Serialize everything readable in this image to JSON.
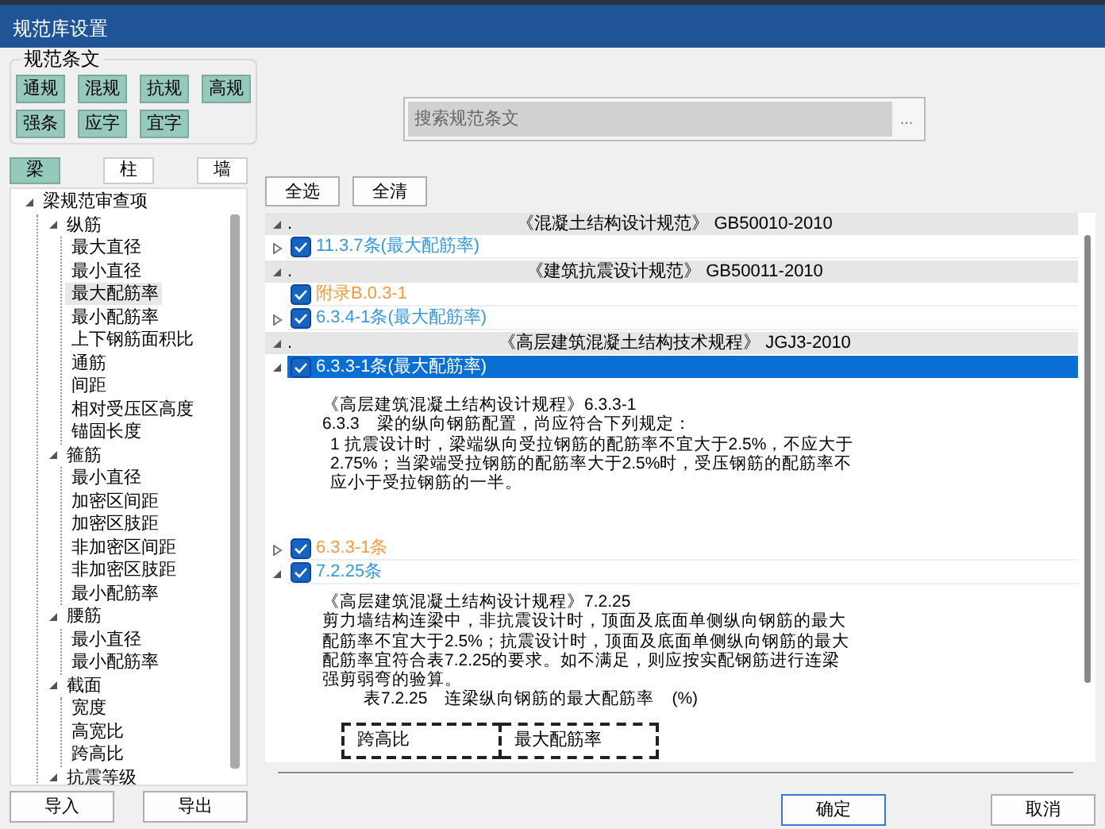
{
  "window": {
    "title": "规范库设置"
  },
  "filter_group": {
    "legend": "规范条文",
    "buttons": [
      {
        "label": "通规",
        "selected": true
      },
      {
        "label": "混规",
        "selected": true
      },
      {
        "label": "抗规",
        "selected": true
      },
      {
        "label": "高规",
        "selected": true
      },
      {
        "label": "强条",
        "selected": true
      },
      {
        "label": "应字",
        "selected": true
      },
      {
        "label": "宜字",
        "selected": true
      }
    ]
  },
  "search": {
    "placeholder": "搜索规范条文",
    "button": "..."
  },
  "member_tabs": [
    {
      "label": "梁",
      "selected": true
    },
    {
      "label": "柱",
      "selected": false
    },
    {
      "label": "墙",
      "selected": false
    }
  ],
  "tree": [
    {
      "label": "梁规范审查项",
      "expanded": true,
      "selected": false,
      "children": [
        {
          "label": "纵筋",
          "expanded": true,
          "selected": false,
          "children": [
            {
              "label": "最大直径",
              "selected": false
            },
            {
              "label": "最小直径",
              "selected": false
            },
            {
              "label": "最大配筋率",
              "selected": true
            },
            {
              "label": "最小配筋率",
              "selected": false
            },
            {
              "label": "上下钢筋面积比",
              "selected": false
            },
            {
              "label": "通筋",
              "selected": false
            },
            {
              "label": "间距",
              "selected": false
            },
            {
              "label": "相对受压区高度",
              "selected": false
            },
            {
              "label": "锚固长度",
              "selected": false
            }
          ]
        },
        {
          "label": "箍筋",
          "expanded": true,
          "selected": false,
          "children": [
            {
              "label": "最小直径",
              "selected": false
            },
            {
              "label": "加密区间距",
              "selected": false
            },
            {
              "label": "加密区肢距",
              "selected": false
            },
            {
              "label": "非加密区间距",
              "selected": false
            },
            {
              "label": "非加密区肢距",
              "selected": false
            },
            {
              "label": "最小配筋率",
              "selected": false
            }
          ]
        },
        {
          "label": "腰筋",
          "expanded": true,
          "selected": false,
          "children": [
            {
              "label": "最小直径",
              "selected": false
            },
            {
              "label": "最小配筋率",
              "selected": false
            }
          ]
        },
        {
          "label": "截面",
          "expanded": true,
          "selected": false,
          "children": [
            {
              "label": "宽度",
              "selected": false
            },
            {
              "label": "高宽比",
              "selected": false
            },
            {
              "label": "跨高比",
              "selected": false
            }
          ]
        },
        {
          "label": "抗震等级",
          "expanded": true,
          "selected": false
        }
      ]
    }
  ],
  "left_buttons": [
    "导入",
    "导出"
  ],
  "list_buttons": [
    "全选",
    "全清"
  ],
  "clauses": [
    {
      "kind": "group",
      "prefix": ".",
      "title": "《混凝土结构设计规范》 GB50010-2010",
      "expanded": true
    },
    {
      "kind": "item",
      "label": "11.3.7条(最大配筋率)",
      "checked": true,
      "expanded": false,
      "selected": false,
      "color": "#3399e0"
    },
    {
      "kind": "group",
      "prefix": ".",
      "title": "《建筑抗震设计规范》 GB50011-2010",
      "expanded": true
    },
    {
      "kind": "item",
      "label": "附录B.0.3-1",
      "checked": true,
      "selected": false,
      "color": "#f39a3c"
    },
    {
      "kind": "item",
      "label": "6.3.4-1条(最大配筋率)",
      "checked": true,
      "expanded": false,
      "selected": false,
      "color": "#3399e0"
    },
    {
      "kind": "group",
      "prefix": ".",
      "title": "《高层建筑混凝土结构技术规程》 JGJ3-2010",
      "expanded": true
    },
    {
      "kind": "item",
      "label": "6.3.3-1条(最大配筋率)",
      "checked": true,
      "expanded": true,
      "selected": true
    },
    {
      "kind": "detail",
      "lines": [
        {
          "kind": "plain",
          "text": "《高层建筑混凝土结构设计规程》6.3.3-1"
        },
        {
          "kind": "plain",
          "text": "6.3.3　梁的纵向钢筋配置，尚应符合下列规定："
        },
        {
          "kind": "indent",
          "text": "1 抗震设计时，梁端纵向受拉钢筋的配筋率不宜大于2.5%，不应大于"
        },
        {
          "kind": "indent",
          "text": "2.75%；当梁端受拉钢筋的配筋率大于2.5%时，受压钢筋的配筋率不"
        },
        {
          "kind": "indent",
          "text": "应小于受拉钢筋的一半。"
        }
      ]
    },
    {
      "kind": "item",
      "label": "6.3.3-1条",
      "checked": true,
      "expanded": false,
      "selected": false,
      "color": "#f39a3c"
    },
    {
      "kind": "item",
      "label": "7.2.25条",
      "checked": true,
      "expanded": true,
      "selected": false,
      "color": "#3399e0"
    },
    {
      "kind": "detail",
      "lines": [
        {
          "kind": "plain",
          "text": "《高层建筑混凝土结构设计规程》7.2.25"
        },
        {
          "kind": "plain",
          "text": "剪力墙结构连梁中，非抗震设计时，顶面及底面单侧纵向钢筋的最大"
        },
        {
          "kind": "plain",
          "text": "配筋率不宜大于2.5%；抗震设计时，顶面及底面单侧纵向钢筋的最大"
        },
        {
          "kind": "plain",
          "text": "配筋率宜符合表7.2.25的要求。如不满足，则应按实配钢筋进行连梁"
        },
        {
          "kind": "plain",
          "text": "强剪弱弯的验算。"
        },
        {
          "kind": "caption",
          "text": "表7.2.25　连梁纵向钢筋的最大配筋率　(%)"
        }
      ],
      "table_header": [
        "跨高比",
        "最大配筋率"
      ]
    }
  ],
  "footer_buttons": [
    "确定",
    "取消"
  ]
}
